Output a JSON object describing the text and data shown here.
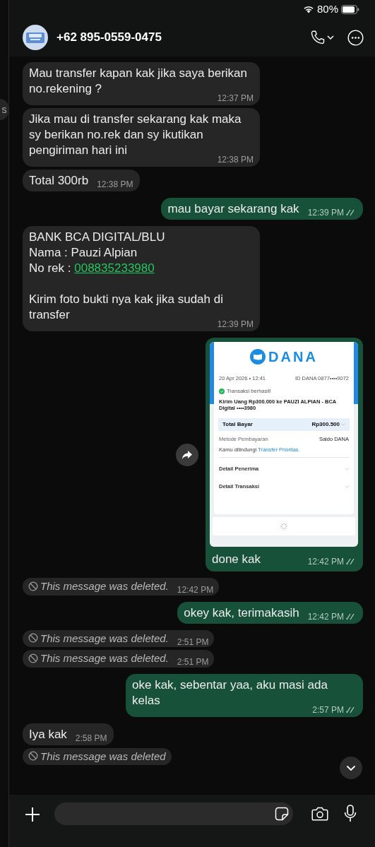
{
  "status_bar": {
    "battery": "80%"
  },
  "sidebar": {
    "fragment": "s"
  },
  "header": {
    "contact": "+62 895-0559-0475"
  },
  "messages": [
    {
      "kind": "text",
      "outgoing": false,
      "text": "Mau transfer kapan kak jika saya berikan no.rekening ?",
      "time": "12:37 PM"
    },
    {
      "kind": "text",
      "outgoing": false,
      "text": "Jika mau di transfer sekarang kak maka sy berikan no.rek dan sy ikutikan pengiriman hari ini",
      "time": "12:38 PM"
    },
    {
      "kind": "text",
      "outgoing": false,
      "text": "Total 300rb",
      "time": "12:38 PM"
    },
    {
      "kind": "text",
      "outgoing": true,
      "text": "mau bayar sekarang kak",
      "time": "12:39 PM",
      "read": true
    },
    {
      "kind": "link",
      "outgoing": false,
      "text_before": "BANK BCA DIGITAL/BLU\nNama : Pauzi Alpian\nNo rek : ",
      "link": "008835233980",
      "text_after": "\n\nKirim foto bukti nya kak jika sudah di transfer",
      "time": "12:39 PM"
    },
    {
      "kind": "image",
      "outgoing": true,
      "caption": "done kak",
      "time": "12:42 PM",
      "read": true,
      "receipt": {
        "logo": "DANA",
        "date": "20 Apr 2026 • 12:41",
        "account": "ID DANA 0877••••9072",
        "status": "Transaksi berhasil!",
        "description": "Kirim Uang Rp300.000 ke PAUZI ALPIAN - BCA Digital ••••3980",
        "total_label": "Total Bayar",
        "total_value": "Rp300.500",
        "method_label": "Metode Pembayaran",
        "method_value": "Saldo DANA",
        "protection_text": "Kamu dilindungi",
        "protection_link": "Transfer Prioritas.",
        "details": [
          "Detail Penerima",
          "Detail Transaksi"
        ]
      }
    },
    {
      "kind": "deleted",
      "outgoing": false,
      "text": "This message was deleted.",
      "time": "12:42 PM"
    },
    {
      "kind": "text",
      "outgoing": true,
      "text": "okey kak, terimakasih",
      "time": "12:42 PM",
      "read": true
    },
    {
      "kind": "deleted",
      "outgoing": false,
      "text": "This message was deleted.",
      "time": "2:51 PM"
    },
    {
      "kind": "deleted",
      "outgoing": false,
      "text": "This message was deleted.",
      "time": "2:51 PM"
    },
    {
      "kind": "text",
      "outgoing": true,
      "text": "oke kak, sebentar yaa, aku masi ada kelas",
      "time": "2:57 PM",
      "read": true
    },
    {
      "kind": "text",
      "outgoing": false,
      "text": "Iya kak",
      "time": "2:58 PM"
    },
    {
      "kind": "deleted",
      "outgoing": false,
      "text": "This message was deleted"
    }
  ]
}
